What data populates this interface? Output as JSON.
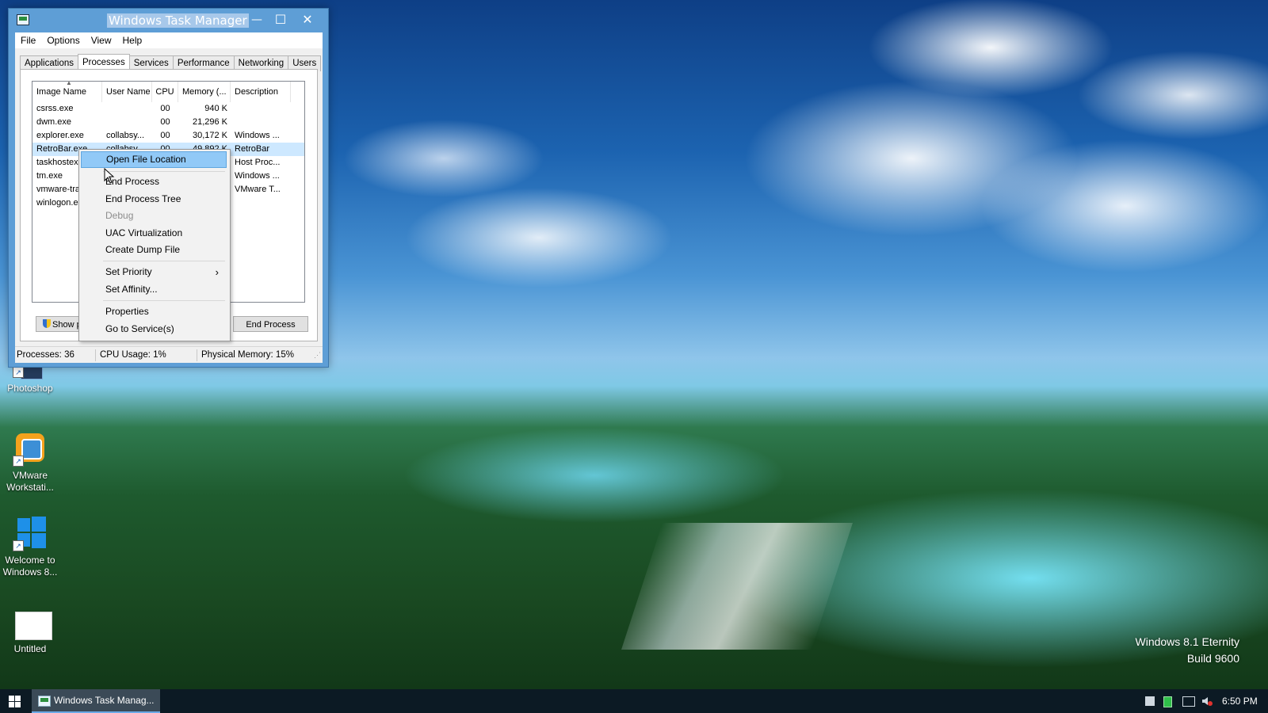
{
  "desktop": {
    "watermark_line1": "Windows 8.1 Eternity",
    "watermark_line2": "Build 9600",
    "icons": [
      {
        "label": "Photoshop"
      },
      {
        "label_line1": "VMware",
        "label_line2": "Workstati..."
      },
      {
        "label_line1": "Welcome to",
        "label_line2": "Windows 8..."
      },
      {
        "label": "Untitled"
      }
    ]
  },
  "task_manager": {
    "title": "Windows Task Manager",
    "controls": {
      "minimize": "—",
      "maximize": "☐",
      "close": "✕"
    },
    "menu": [
      "File",
      "Options",
      "View",
      "Help"
    ],
    "tabs": [
      "Applications",
      "Processes",
      "Services",
      "Performance",
      "Networking",
      "Users"
    ],
    "active_tab": "Processes",
    "columns": [
      "Image Name",
      "User Name",
      "CPU",
      "Memory (...",
      "Description"
    ],
    "processes": [
      {
        "name": "csrss.exe",
        "user": "",
        "cpu": "00",
        "memory": "940 K",
        "description": ""
      },
      {
        "name": "dwm.exe",
        "user": "",
        "cpu": "00",
        "memory": "21,296 K",
        "description": ""
      },
      {
        "name": "explorer.exe",
        "user": "collabsy...",
        "cpu": "00",
        "memory": "30,172 K",
        "description": "Windows ..."
      },
      {
        "name": "RetroBar.exe",
        "user": "collabsy...",
        "cpu": "00",
        "memory": "49,892 K",
        "description": "RetroBar"
      },
      {
        "name": "taskhostex",
        "user": "",
        "cpu": "",
        "memory": "",
        "description": "Host Proc..."
      },
      {
        "name": "tm.exe",
        "user": "",
        "cpu": "",
        "memory": "",
        "description": "Windows ..."
      },
      {
        "name": "vmware-tra",
        "user": "",
        "cpu": "",
        "memory": "",
        "description": "VMware T..."
      },
      {
        "name": "winlogon.e",
        "user": "",
        "cpu": "",
        "memory": "",
        "description": ""
      }
    ],
    "selected_process": "RetroBar.exe",
    "show_processes_button": "Show p",
    "end_process_button": "End Process",
    "status": {
      "processes": "Processes: 36",
      "cpu": "CPU Usage: 1%",
      "memory": "Physical Memory: 15%"
    }
  },
  "context_menu": {
    "items": [
      {
        "label": "Open File Location",
        "state": "highlighted"
      },
      {
        "label": "End Process",
        "state": "normal"
      },
      {
        "label": "End Process Tree",
        "state": "normal"
      },
      {
        "label": "Debug",
        "state": "disabled"
      },
      {
        "label": "UAC Virtualization",
        "state": "normal"
      },
      {
        "label": "Create Dump File",
        "state": "normal"
      },
      {
        "label": "Set Priority",
        "state": "submenu"
      },
      {
        "label": "Set Affinity...",
        "state": "normal"
      },
      {
        "label": "Properties",
        "state": "normal"
      },
      {
        "label": "Go to Service(s)",
        "state": "normal"
      }
    ],
    "submenu_glyph": "›"
  },
  "taskbar": {
    "task_label": "Windows Task Manag...",
    "clock": "6:50 PM"
  },
  "colors": {
    "title_bar": "#5e9ed6",
    "selection": "#cde8ff",
    "menu_highlight": "#91c9f7",
    "taskbar": "#0c1a24"
  }
}
